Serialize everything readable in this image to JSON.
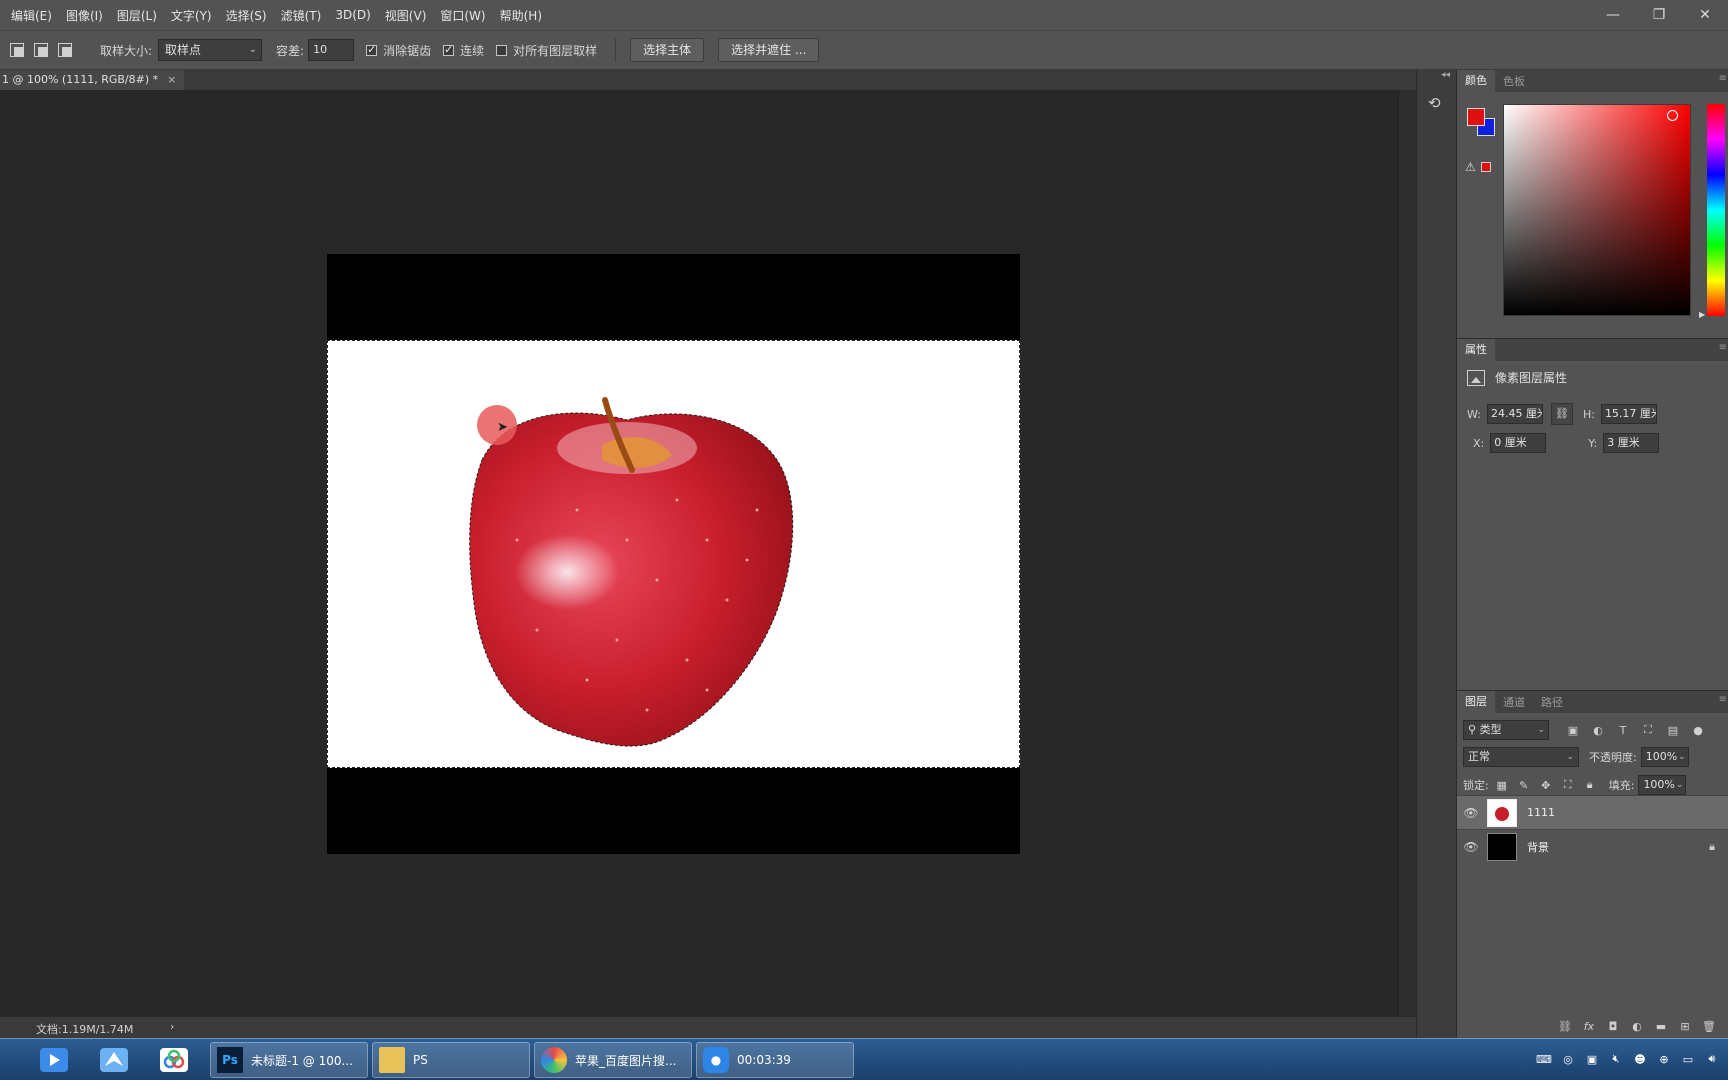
{
  "menu": [
    "编辑(E)",
    "图像(I)",
    "图层(L)",
    "文字(Y)",
    "选择(S)",
    "滤镜(T)",
    "3D(D)",
    "视图(V)",
    "窗口(W)",
    "帮助(H)"
  ],
  "window_controls": {
    "minimize": "—",
    "restore": "❐",
    "close": "✕"
  },
  "options": {
    "sample_size_label": "取样大小:",
    "sample_size_value": "取样点",
    "tolerance_label": "容差:",
    "tolerance_value": "10",
    "antialias_label": "消除锯齿",
    "antialias_checked": true,
    "contiguous_label": "连续",
    "contiguous_checked": true,
    "sample_all_label": "对所有图层取样",
    "sample_all_checked": false,
    "select_subject_button": "选择主体",
    "select_mask_button": "选择并遮住 ..."
  },
  "document_tab": {
    "title": "1 @ 100% (1111, RGB/8#) *",
    "close": "×"
  },
  "status": {
    "doc_size": "文档:1.19M/1.74M",
    "arrow": "›"
  },
  "color_panel": {
    "tabs": [
      "颜色",
      "色板"
    ],
    "foreground": "#e01010",
    "background": "#1020e0"
  },
  "properties_panel": {
    "tab": "属性",
    "header": "像素图层属性",
    "w_label": "W:",
    "w_value": "24.45 厘米",
    "h_label": "H:",
    "h_value": "15.17 厘米",
    "x_label": "X:",
    "x_value": "0 厘米",
    "y_label": "Y:",
    "y_value": "3 厘米"
  },
  "layers_panel": {
    "tabs": [
      "图层",
      "通道",
      "路径"
    ],
    "filter_value": "类型",
    "blend_mode": "正常",
    "opacity_label": "不透明度:",
    "opacity_value": "100%",
    "lock_label": "锁定:",
    "fill_label": "填充:",
    "fill_value": "100%",
    "layers": [
      {
        "name": "1111",
        "selected": true,
        "locked": false
      },
      {
        "name": "背景",
        "selected": false,
        "locked": true
      }
    ]
  },
  "taskbar": {
    "tasks": [
      {
        "label": "未标题-1 @ 100...",
        "icon": "photoshop-icon"
      },
      {
        "label": "PS",
        "icon": "folder-icon"
      },
      {
        "label": "苹果_百度图片搜...",
        "icon": "browser-icon"
      },
      {
        "label": "00:03:39",
        "icon": "recorder-icon"
      }
    ]
  }
}
